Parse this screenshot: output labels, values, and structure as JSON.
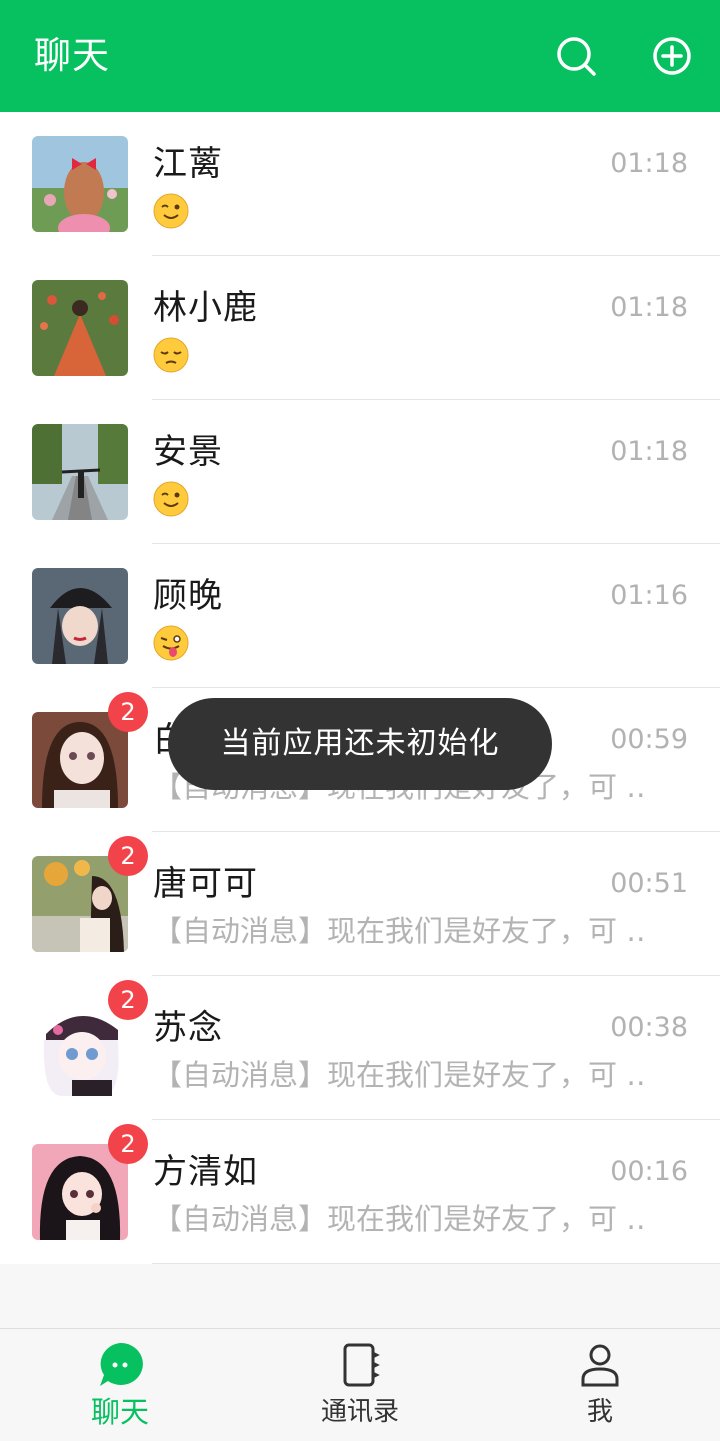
{
  "header": {
    "title": "聊天"
  },
  "colors": {
    "accent": "#07c160",
    "badge": "#f2424a",
    "toast": "#333333"
  },
  "icons": {
    "search": "search-icon",
    "add": "plus-circle-icon"
  },
  "chats": [
    {
      "name": "江蓠",
      "time": "01:18",
      "message": "",
      "emoji": "winking-face"
    },
    {
      "name": "林小鹿",
      "time": "01:18",
      "message": "",
      "emoji": "pensive-face"
    },
    {
      "name": "安景",
      "time": "01:18",
      "message": "",
      "emoji": "winking-face"
    },
    {
      "name": "顾晚",
      "time": "01:16",
      "message": "",
      "emoji": "tongue-out-face"
    },
    {
      "name": "白",
      "time": "00:59",
      "message": "【自动消息】现在我们是好友了，可 ‥",
      "badge": "2"
    },
    {
      "name": "唐可可",
      "time": "00:51",
      "message": "【自动消息】现在我们是好友了，可 ‥",
      "badge": "2"
    },
    {
      "name": "苏念",
      "time": "00:38",
      "message": "【自动消息】现在我们是好友了，可 ‥",
      "badge": "2"
    },
    {
      "name": "方清如",
      "time": "00:16",
      "message": "【自动消息】现在我们是好友了，可 ‥",
      "badge": "2"
    }
  ],
  "toast": "当前应用还未初始化",
  "tabs": [
    {
      "label": "聊天",
      "icon": "chat-bubble-icon",
      "active": true
    },
    {
      "label": "通讯录",
      "icon": "contacts-book-icon",
      "active": false
    },
    {
      "label": "我",
      "icon": "user-icon",
      "active": false
    }
  ]
}
